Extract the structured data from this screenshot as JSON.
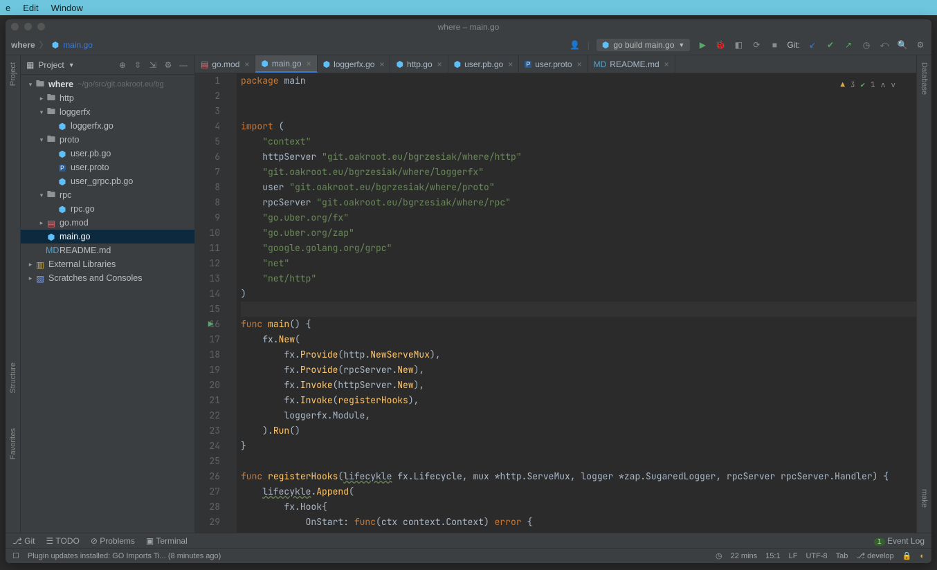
{
  "mac_menu": [
    "e",
    "Edit",
    "Window"
  ],
  "window_title": "where – main.go",
  "breadcrumb": {
    "project": "where",
    "file": "main.go"
  },
  "run_config": "go build main.go",
  "git_label": "Git:",
  "side_left": [
    "Project",
    "Structure",
    "Favorites"
  ],
  "side_right": [
    "Database",
    "make"
  ],
  "project_panel_label": "Project",
  "tree": [
    {
      "d": 0,
      "arrow": "▾",
      "icon": "dir",
      "label": "where",
      "path": "~/go/src/git.oakroot.eu/bg",
      "sel": false,
      "bold": true
    },
    {
      "d": 1,
      "arrow": "▸",
      "icon": "dir",
      "label": "http"
    },
    {
      "d": 1,
      "arrow": "▾",
      "icon": "dir",
      "label": "loggerfx"
    },
    {
      "d": 2,
      "arrow": "",
      "icon": "go",
      "label": "loggerfx.go"
    },
    {
      "d": 1,
      "arrow": "▾",
      "icon": "dir",
      "label": "proto"
    },
    {
      "d": 2,
      "arrow": "",
      "icon": "go",
      "label": "user.pb.go"
    },
    {
      "d": 2,
      "arrow": "",
      "icon": "proto",
      "label": "user.proto"
    },
    {
      "d": 2,
      "arrow": "",
      "icon": "go",
      "label": "user_grpc.pb.go"
    },
    {
      "d": 1,
      "arrow": "▾",
      "icon": "dir",
      "label": "rpc"
    },
    {
      "d": 2,
      "arrow": "",
      "icon": "go",
      "label": "rpc.go"
    },
    {
      "d": 1,
      "arrow": "▸",
      "icon": "mod",
      "label": "go.mod"
    },
    {
      "d": 1,
      "arrow": "",
      "icon": "go",
      "label": "main.go",
      "sel": true
    },
    {
      "d": 1,
      "arrow": "",
      "icon": "md",
      "label": "README.md"
    },
    {
      "d": 0,
      "arrow": "▸",
      "icon": "lib",
      "label": "External Libraries"
    },
    {
      "d": 0,
      "arrow": "▸",
      "icon": "scratch",
      "label": "Scratches and Consoles"
    }
  ],
  "tabs": [
    {
      "icon": "mod",
      "label": "go.mod",
      "active": false
    },
    {
      "icon": "go",
      "label": "main.go",
      "active": true
    },
    {
      "icon": "go",
      "label": "loggerfx.go",
      "active": false
    },
    {
      "icon": "go",
      "label": "http.go",
      "active": false
    },
    {
      "icon": "go",
      "label": "user.pb.go",
      "active": false
    },
    {
      "icon": "proto",
      "label": "user.proto",
      "active": false
    },
    {
      "icon": "md",
      "label": "README.md",
      "active": false
    }
  ],
  "inspection": {
    "warn": "3",
    "ok": "1"
  },
  "code_lines": [
    {
      "n": 1,
      "html": "<span class='kw'>package</span> <span class='pkg'>main</span>"
    },
    {
      "n": 2,
      "html": ""
    },
    {
      "n": 3,
      "html": ""
    },
    {
      "n": 4,
      "html": "<span class='kw'>import</span> ("
    },
    {
      "n": 5,
      "html": "    <span class='str'>\"context\"</span>"
    },
    {
      "n": 6,
      "html": "    <span class='id'>httpServer</span> <span class='str'>\"git.oakroot.eu/bgrzesiak/where/http\"</span>"
    },
    {
      "n": 7,
      "html": "    <span class='str'>\"git.oakroot.eu/bgrzesiak/where/loggerfx\"</span>"
    },
    {
      "n": 8,
      "html": "    <span class='id'>user</span> <span class='str'>\"git.oakroot.eu/bgrzesiak/where/proto\"</span>"
    },
    {
      "n": 8,
      "html": "    <span class='id'>rpcServer</span> <span class='str'>\"git.oakroot.eu/bgrzesiak/where/rpc\"</span>"
    },
    {
      "n": 9,
      "html": "    <span class='str'>\"go.uber.org/fx\"</span>"
    },
    {
      "n": 10,
      "html": "    <span class='str'>\"go.uber.org/zap\"</span>"
    },
    {
      "n": 11,
      "html": "    <span class='str'>\"google.golang.org/grpc\"</span>"
    },
    {
      "n": 12,
      "html": "    <span class='str'>\"net\"</span>"
    },
    {
      "n": 13,
      "html": "    <span class='str'>\"net/http\"</span>"
    },
    {
      "n": 14,
      "html": ")"
    },
    {
      "n": 15,
      "html": "",
      "hl": true
    },
    {
      "n": 16,
      "html": "<span class='kw'>func</span> <span class='fn'>main</span>() {",
      "run": true
    },
    {
      "n": 17,
      "html": "    fx.<span class='call'>New</span>("
    },
    {
      "n": 18,
      "html": "        fx.<span class='call'>Provide</span>(http.<span class='fn'>NewServeMux</span>),"
    },
    {
      "n": 19,
      "html": "        fx.<span class='call'>Provide</span>(rpcServer.<span class='fn'>New</span>),"
    },
    {
      "n": 20,
      "html": "        fx.<span class='call'>Invoke</span>(httpServer.<span class='fn'>New</span>),"
    },
    {
      "n": 21,
      "html": "        fx.<span class='call'>Invoke</span>(<span class='fn'>registerHooks</span>),"
    },
    {
      "n": 22,
      "html": "        loggerfx.<span class='id'>Module</span>,"
    },
    {
      "n": 23,
      "html": "    ).<span class='call'>Run</span>()"
    },
    {
      "n": 24,
      "html": "}"
    },
    {
      "n": 25,
      "html": ""
    },
    {
      "n": 26,
      "html": "<span class='kw'>func</span> <span class='fn'>registerHooks</span>(<span class='spell'>lifecykle</span> fx.Lifecycle, mux *http.ServeMux, logger *zap.SugaredLogger, rpcServer rpcServer.Handler) {"
    },
    {
      "n": 27,
      "html": "    <span class='spell'>lifecykle</span>.<span class='call'>Append</span>("
    },
    {
      "n": 28,
      "html": "        fx.Hook{"
    },
    {
      "n": 29,
      "html": "            OnStart: <span class='kw'>func</span>(ctx context.Context) <span class='kw'>error</span> {"
    }
  ],
  "bottom_tools": [
    "Git",
    "TODO",
    "Problems",
    "Terminal"
  ],
  "event_log_label": "Event Log",
  "event_log_badge": "1",
  "status": {
    "msg": "Plugin updates installed: GO Imports Ti... (8 minutes ago)",
    "time": "22 mins",
    "pos": "15:1",
    "eol": "LF",
    "enc": "UTF-8",
    "indent": "Tab",
    "branch": "develop"
  }
}
